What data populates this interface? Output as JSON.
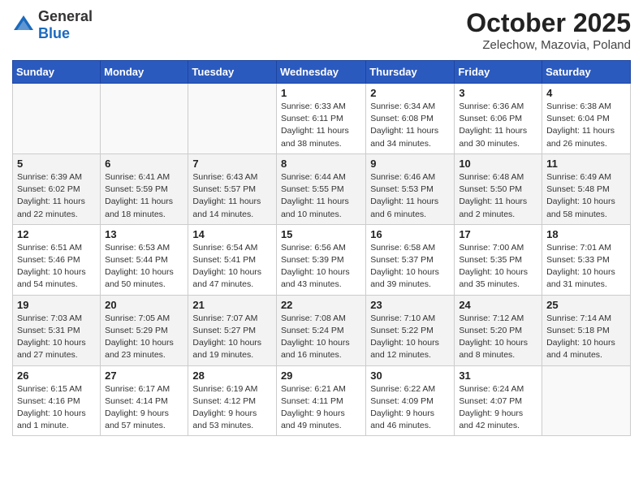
{
  "header": {
    "logo_general": "General",
    "logo_blue": "Blue",
    "month_title": "October 2025",
    "location": "Zelechow, Mazovia, Poland"
  },
  "days_of_week": [
    "Sunday",
    "Monday",
    "Tuesday",
    "Wednesday",
    "Thursday",
    "Friday",
    "Saturday"
  ],
  "weeks": [
    {
      "shade": false,
      "days": [
        {
          "num": "",
          "info": ""
        },
        {
          "num": "",
          "info": ""
        },
        {
          "num": "",
          "info": ""
        },
        {
          "num": "1",
          "info": "Sunrise: 6:33 AM\nSunset: 6:11 PM\nDaylight: 11 hours\nand 38 minutes."
        },
        {
          "num": "2",
          "info": "Sunrise: 6:34 AM\nSunset: 6:08 PM\nDaylight: 11 hours\nand 34 minutes."
        },
        {
          "num": "3",
          "info": "Sunrise: 6:36 AM\nSunset: 6:06 PM\nDaylight: 11 hours\nand 30 minutes."
        },
        {
          "num": "4",
          "info": "Sunrise: 6:38 AM\nSunset: 6:04 PM\nDaylight: 11 hours\nand 26 minutes."
        }
      ]
    },
    {
      "shade": true,
      "days": [
        {
          "num": "5",
          "info": "Sunrise: 6:39 AM\nSunset: 6:02 PM\nDaylight: 11 hours\nand 22 minutes."
        },
        {
          "num": "6",
          "info": "Sunrise: 6:41 AM\nSunset: 5:59 PM\nDaylight: 11 hours\nand 18 minutes."
        },
        {
          "num": "7",
          "info": "Sunrise: 6:43 AM\nSunset: 5:57 PM\nDaylight: 11 hours\nand 14 minutes."
        },
        {
          "num": "8",
          "info": "Sunrise: 6:44 AM\nSunset: 5:55 PM\nDaylight: 11 hours\nand 10 minutes."
        },
        {
          "num": "9",
          "info": "Sunrise: 6:46 AM\nSunset: 5:53 PM\nDaylight: 11 hours\nand 6 minutes."
        },
        {
          "num": "10",
          "info": "Sunrise: 6:48 AM\nSunset: 5:50 PM\nDaylight: 11 hours\nand 2 minutes."
        },
        {
          "num": "11",
          "info": "Sunrise: 6:49 AM\nSunset: 5:48 PM\nDaylight: 10 hours\nand 58 minutes."
        }
      ]
    },
    {
      "shade": false,
      "days": [
        {
          "num": "12",
          "info": "Sunrise: 6:51 AM\nSunset: 5:46 PM\nDaylight: 10 hours\nand 54 minutes."
        },
        {
          "num": "13",
          "info": "Sunrise: 6:53 AM\nSunset: 5:44 PM\nDaylight: 10 hours\nand 50 minutes."
        },
        {
          "num": "14",
          "info": "Sunrise: 6:54 AM\nSunset: 5:41 PM\nDaylight: 10 hours\nand 47 minutes."
        },
        {
          "num": "15",
          "info": "Sunrise: 6:56 AM\nSunset: 5:39 PM\nDaylight: 10 hours\nand 43 minutes."
        },
        {
          "num": "16",
          "info": "Sunrise: 6:58 AM\nSunset: 5:37 PM\nDaylight: 10 hours\nand 39 minutes."
        },
        {
          "num": "17",
          "info": "Sunrise: 7:00 AM\nSunset: 5:35 PM\nDaylight: 10 hours\nand 35 minutes."
        },
        {
          "num": "18",
          "info": "Sunrise: 7:01 AM\nSunset: 5:33 PM\nDaylight: 10 hours\nand 31 minutes."
        }
      ]
    },
    {
      "shade": true,
      "days": [
        {
          "num": "19",
          "info": "Sunrise: 7:03 AM\nSunset: 5:31 PM\nDaylight: 10 hours\nand 27 minutes."
        },
        {
          "num": "20",
          "info": "Sunrise: 7:05 AM\nSunset: 5:29 PM\nDaylight: 10 hours\nand 23 minutes."
        },
        {
          "num": "21",
          "info": "Sunrise: 7:07 AM\nSunset: 5:27 PM\nDaylight: 10 hours\nand 19 minutes."
        },
        {
          "num": "22",
          "info": "Sunrise: 7:08 AM\nSunset: 5:24 PM\nDaylight: 10 hours\nand 16 minutes."
        },
        {
          "num": "23",
          "info": "Sunrise: 7:10 AM\nSunset: 5:22 PM\nDaylight: 10 hours\nand 12 minutes."
        },
        {
          "num": "24",
          "info": "Sunrise: 7:12 AM\nSunset: 5:20 PM\nDaylight: 10 hours\nand 8 minutes."
        },
        {
          "num": "25",
          "info": "Sunrise: 7:14 AM\nSunset: 5:18 PM\nDaylight: 10 hours\nand 4 minutes."
        }
      ]
    },
    {
      "shade": false,
      "days": [
        {
          "num": "26",
          "info": "Sunrise: 6:15 AM\nSunset: 4:16 PM\nDaylight: 10 hours\nand 1 minute."
        },
        {
          "num": "27",
          "info": "Sunrise: 6:17 AM\nSunset: 4:14 PM\nDaylight: 9 hours\nand 57 minutes."
        },
        {
          "num": "28",
          "info": "Sunrise: 6:19 AM\nSunset: 4:12 PM\nDaylight: 9 hours\nand 53 minutes."
        },
        {
          "num": "29",
          "info": "Sunrise: 6:21 AM\nSunset: 4:11 PM\nDaylight: 9 hours\nand 49 minutes."
        },
        {
          "num": "30",
          "info": "Sunrise: 6:22 AM\nSunset: 4:09 PM\nDaylight: 9 hours\nand 46 minutes."
        },
        {
          "num": "31",
          "info": "Sunrise: 6:24 AM\nSunset: 4:07 PM\nDaylight: 9 hours\nand 42 minutes."
        },
        {
          "num": "",
          "info": ""
        }
      ]
    }
  ]
}
